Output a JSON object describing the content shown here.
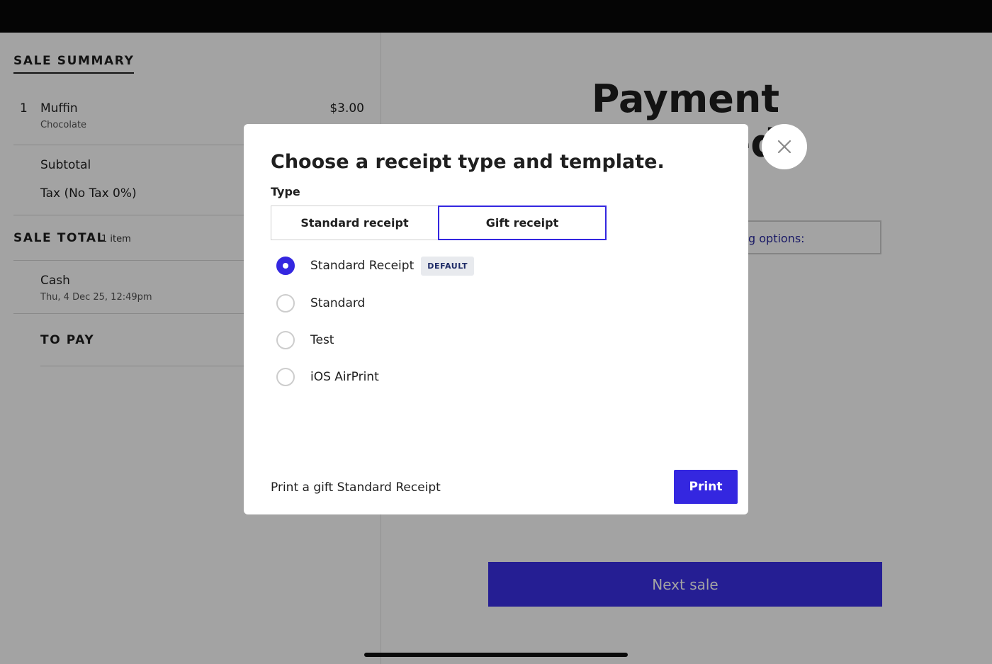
{
  "sale_summary": {
    "heading": "SALE SUMMARY",
    "line_item": {
      "qty": "1",
      "name": "Muffin",
      "variant": "Chocolate",
      "price": "$3.00"
    },
    "subtotal_label": "Subtotal",
    "tax_label": "Tax (No Tax 0%)",
    "sale_total_label": "SALE TOTAL",
    "sale_total_count": "1 item",
    "payment": {
      "method": "Cash",
      "date": "Thu, 4 Dec 25, 12:49pm"
    },
    "to_pay_label": "TO PAY"
  },
  "payment_panel": {
    "title": "Payment received",
    "options_text_partial": "g options:",
    "next_sale_label": "Next sale"
  },
  "modal": {
    "title": "Choose a receipt type and template.",
    "type_label": "Type",
    "type_options": [
      {
        "label": "Standard receipt",
        "selected": false
      },
      {
        "label": "Gift receipt",
        "selected": true
      }
    ],
    "templates": [
      {
        "label": "Standard Receipt",
        "badge": "DEFAULT",
        "checked": true
      },
      {
        "label": "Standard",
        "checked": false
      },
      {
        "label": "Test",
        "checked": false
      },
      {
        "label": "iOS AirPrint",
        "checked": false
      }
    ],
    "footer_text": "Print a gift Standard Receipt",
    "print_label": "Print"
  },
  "icons": {
    "close": "close-icon"
  },
  "colors": {
    "accent": "#3427e0",
    "next_sale": "#3a2fe6",
    "status_bar": "#050505"
  }
}
